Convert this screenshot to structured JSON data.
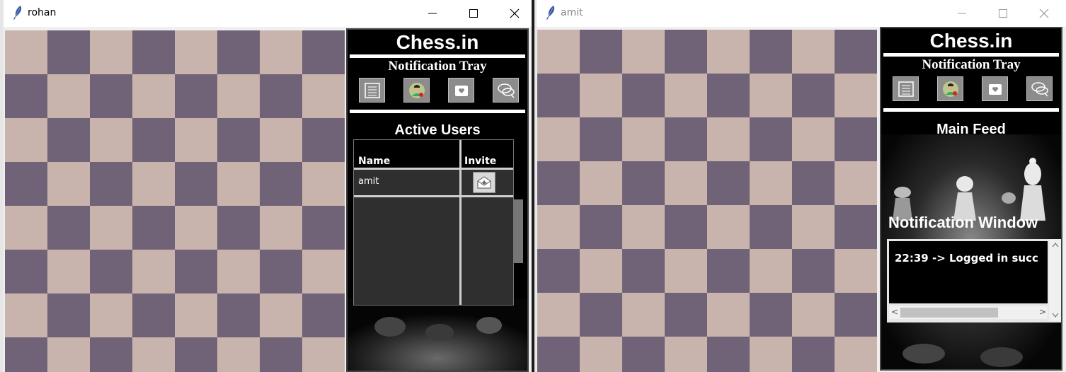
{
  "windows": {
    "rohan": {
      "title": "rohan",
      "brand": "Chess.in",
      "tray_title": "Notification Tray",
      "section_title": "Active Users",
      "table": {
        "columns": [
          "Name",
          "Invite"
        ],
        "rows": [
          {
            "name": "amit"
          }
        ]
      }
    },
    "amit": {
      "title": "amit",
      "brand": "Chess.in",
      "tray_title": "Notification Tray",
      "section_title": "Main Feed",
      "notification_title": "Notification Window",
      "notifications": [
        "22:39 -> Logged in succ"
      ]
    }
  },
  "tray_icons": [
    "list-icon",
    "profile-icon",
    "wallet-icon",
    "chat-icon"
  ],
  "window_controls": [
    "minimize-icon",
    "maximize-icon",
    "close-icon"
  ],
  "colors": {
    "board_light": "#c8b4ac",
    "board_dark": "#716377",
    "panel_bg": "#000000",
    "table_bg": "#2f2f2f"
  }
}
